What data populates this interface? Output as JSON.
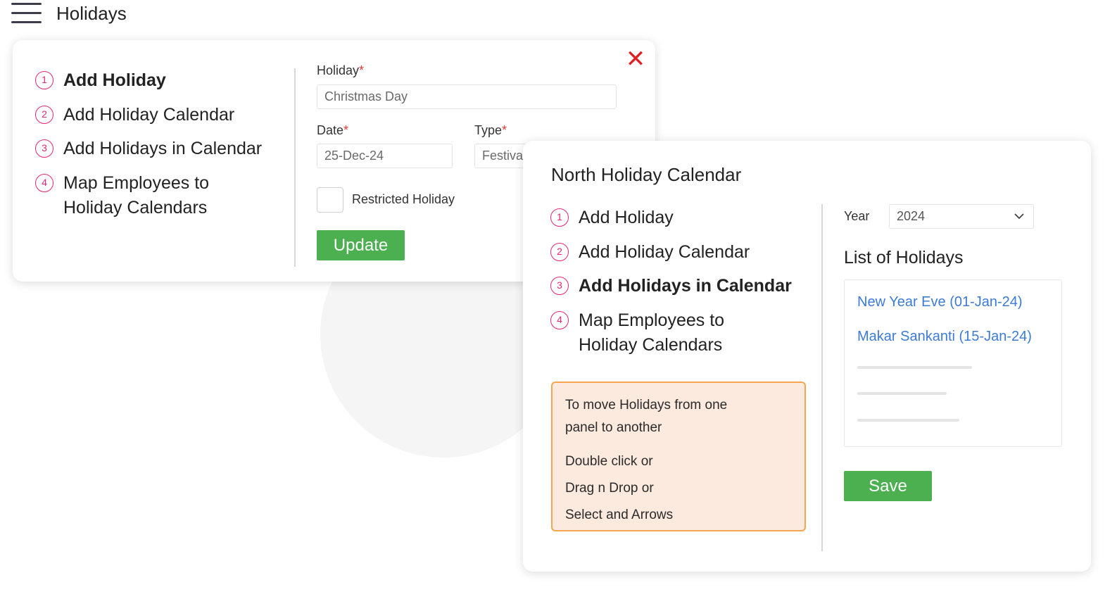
{
  "header": {
    "title": "Holidays",
    "menu_icon": "hamburger-menu-icon"
  },
  "accent_colors": {
    "step": "#e4267a",
    "button": "#4caf50",
    "link": "#3c7bd6",
    "note_border": "#f5a651",
    "note_bg": "#fdeadf",
    "close": "#e02020"
  },
  "add_holiday_card": {
    "close_icon": "close-icon",
    "steps": [
      {
        "num": "1",
        "label": "Add Holiday",
        "active": true
      },
      {
        "num": "2",
        "label": "Add Holiday Calendar",
        "active": false
      },
      {
        "num": "3",
        "label": "Add Holidays in Calendar",
        "active": false
      },
      {
        "num": "4",
        "label_line1": "Map Employees to",
        "label_line2": "Holiday Calendars",
        "active": false
      }
    ],
    "form": {
      "holiday_label": "Holiday",
      "holiday_value": "Christmas Day",
      "date_label": "Date",
      "date_value": "25-Dec-24",
      "type_label": "Type",
      "type_value": "Festival",
      "required_mark": "*",
      "restricted_label": "Restricted Holiday",
      "restricted_checked": false,
      "update_label": "Update"
    }
  },
  "calendar_card": {
    "title": "North Holiday Calendar",
    "steps": [
      {
        "num": "1",
        "label": "Add Holiday",
        "active": false
      },
      {
        "num": "2",
        "label": "Add Holiday Calendar",
        "active": false
      },
      {
        "num": "3",
        "label": "Add Holidays in Calendar",
        "active": true
      },
      {
        "num": "4",
        "label_line1": "Map Employees to",
        "label_line2": "Holiday Calendars",
        "active": false
      }
    ],
    "note": {
      "line1": "To move Holidays from one",
      "line2": "panel to another",
      "line3": "Double click or",
      "line4": "Drag n Drop or",
      "line5": "Select and Arrows"
    },
    "year_label": "Year",
    "year_value": "2024",
    "list_title": "List of Holidays",
    "holidays": [
      "New Year Eve (01-Jan-24)",
      "Makar Sankanti (15-Jan-24)"
    ],
    "save_label": "Save"
  }
}
